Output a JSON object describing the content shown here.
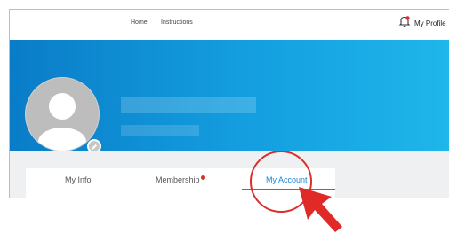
{
  "nav": {
    "home_label": "Home",
    "instructions_label": "Instructions",
    "profile_label": "My Profile",
    "profile_icon": "bell-icon"
  },
  "profile_header": {
    "avatar_icon": "user-avatar-icon",
    "edit_icon": "pencil-icon"
  },
  "tabs": [
    {
      "label": "My Info",
      "active": false
    },
    {
      "label": "Membership",
      "active": false,
      "has_notification_badge": true
    },
    {
      "label": "My Account",
      "active": true
    }
  ],
  "annotation": {
    "highlight_target": "My Account",
    "highlight_color": "#d6312c",
    "pointer_icon": "red-arrow-pointer-icon"
  },
  "colors": {
    "banner_start": "#0a7cc7",
    "banner_end": "#1fb6ea",
    "active_tab": "#1a86d0",
    "badge": "#d5312d"
  }
}
